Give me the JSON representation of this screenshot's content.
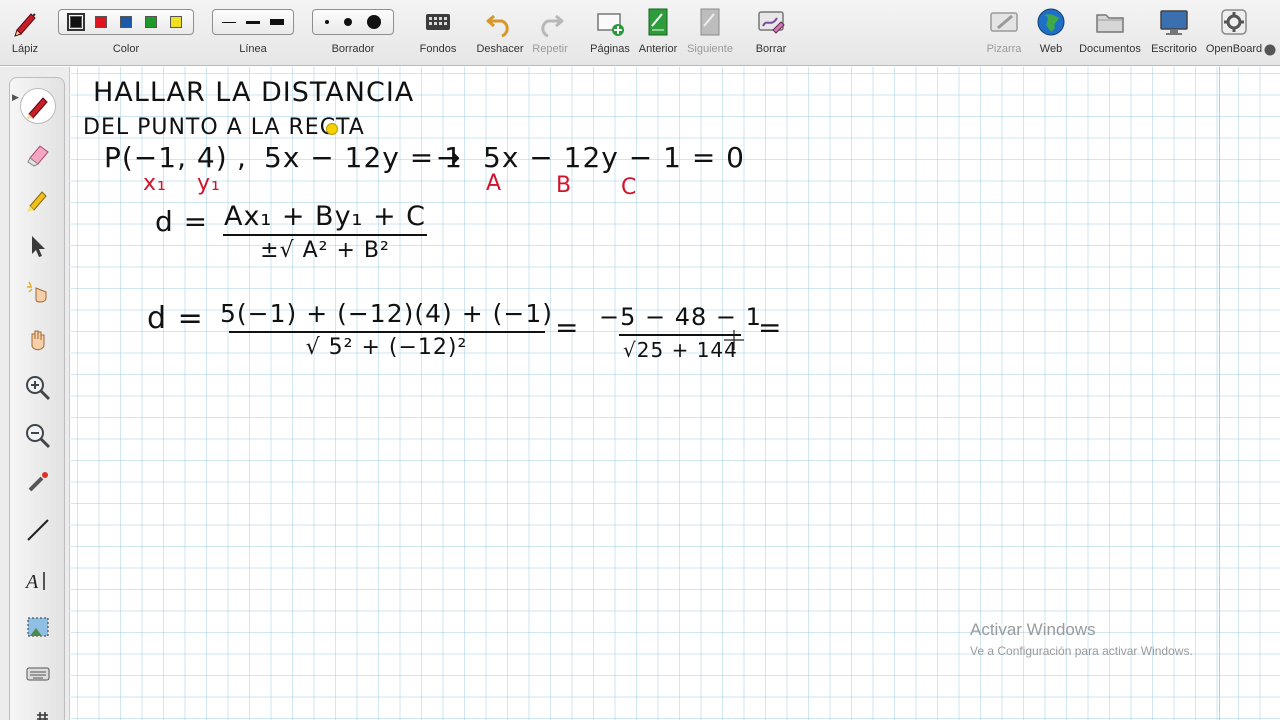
{
  "toolbar": {
    "lapiz": "Lápiz",
    "color": "Color",
    "linea": "Línea",
    "borrador": "Borrador",
    "fondos": "Fondos",
    "deshacer": "Deshacer",
    "repetir": "Repetir",
    "paginas": "Páginas",
    "anterior": "Anterior",
    "siguiente": "Siguiente",
    "borrar": "Borrar",
    "pizarra": "Pizarra",
    "web": "Web",
    "documentos": "Documentos",
    "escritorio": "Escritorio",
    "openboard": "OpenBoard",
    "colors": [
      "#111111",
      "#e0141e",
      "#1a5aa8",
      "#1e9a2a",
      "#f0e020"
    ]
  },
  "board": {
    "title_line1": "HALLAR LA DISTANCIA",
    "title_line2": "DEL PUNTO A LA RECTA",
    "point": "P(−1, 4)",
    "comma": ",",
    "line_eq": "5x − 12y = 1",
    "arrow": "→",
    "line_std": "5x − 12y − 1 = 0",
    "label_x1": "x₁",
    "label_y1": "y₁",
    "label_a": "A",
    "label_b": "B",
    "label_c": "C",
    "formula_d": "d =",
    "formula_num": "Ax₁ + By₁ + C",
    "formula_den": "±√ A² + B²",
    "calc_d": "d =",
    "calc_num": "5(−1) + (−12)(4) + (−1)",
    "calc_den": "√ 5² + (−12)²",
    "eq1": "=",
    "calc2_num": "−5 − 48 − 1",
    "calc2_den": "√25 + 144",
    "eq2": "="
  },
  "watermark": {
    "line1": "Activar Windows",
    "line2": "Ve a Configuración para activar Windows."
  }
}
